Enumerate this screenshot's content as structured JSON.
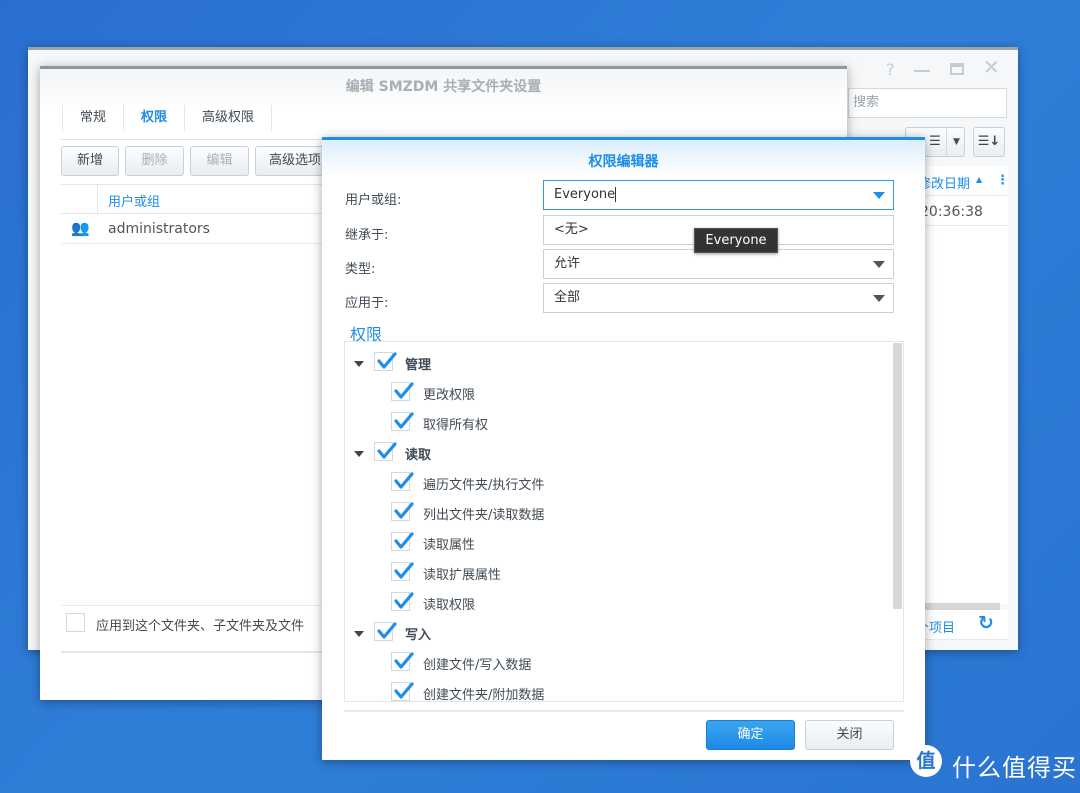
{
  "background_window": {
    "search_placeholder": "搜索",
    "column_header": "修改日期",
    "row_time": "20:36:38",
    "footer_text": "个项目",
    "controls": [
      "help-icon",
      "minimize-icon",
      "maximize-icon",
      "close-icon"
    ]
  },
  "edit_dialog": {
    "title": "编辑 SMZDM 共享文件夹设置",
    "tabs": [
      {
        "label": "常规"
      },
      {
        "label": "权限",
        "active": true
      },
      {
        "label": "高级权限"
      }
    ],
    "toolbar": {
      "add": "新增",
      "delete": "删除",
      "edit": "编辑",
      "advanced": "高级选项"
    },
    "table": {
      "header": "用户或组",
      "rows": [
        {
          "name": "administrators",
          "icon": "group-icon"
        }
      ]
    },
    "apply_checkbox": {
      "label": "应用到这个文件夹、子文件夹及文件",
      "checked": false
    }
  },
  "perm_editor": {
    "title": "权限编辑器",
    "fields": {
      "user_label": "用户或组:",
      "user_value": "Everyone",
      "inherit_label": "继承于:",
      "inherit_value": "<无>",
      "type_label": "类型:",
      "type_value": "允许",
      "apply_label": "应用于:",
      "apply_value": "全部"
    },
    "tooltip": "Everyone",
    "section_title": "权限",
    "tree": [
      {
        "label": "管理",
        "group": true,
        "checked": true
      },
      {
        "label": "更改权限",
        "checked": true
      },
      {
        "label": "取得所有权",
        "checked": true
      },
      {
        "label": "读取",
        "group": true,
        "checked": true
      },
      {
        "label": "遍历文件夹/执行文件",
        "checked": true
      },
      {
        "label": "列出文件夹/读取数据",
        "checked": true
      },
      {
        "label": "读取属性",
        "checked": true
      },
      {
        "label": "读取扩展属性",
        "checked": true
      },
      {
        "label": "读取权限",
        "checked": true
      },
      {
        "label": "写入",
        "group": true,
        "checked": true
      },
      {
        "label": "创建文件/写入数据",
        "checked": true
      },
      {
        "label": "创建文件夹/附加数据",
        "checked": true
      }
    ],
    "ok": "确定",
    "close": "关闭"
  },
  "watermark": {
    "logo_char": "值",
    "text": "什么值得买"
  },
  "colors": {
    "accent": "#1e8ee9",
    "desktop": "#2d78d4"
  }
}
